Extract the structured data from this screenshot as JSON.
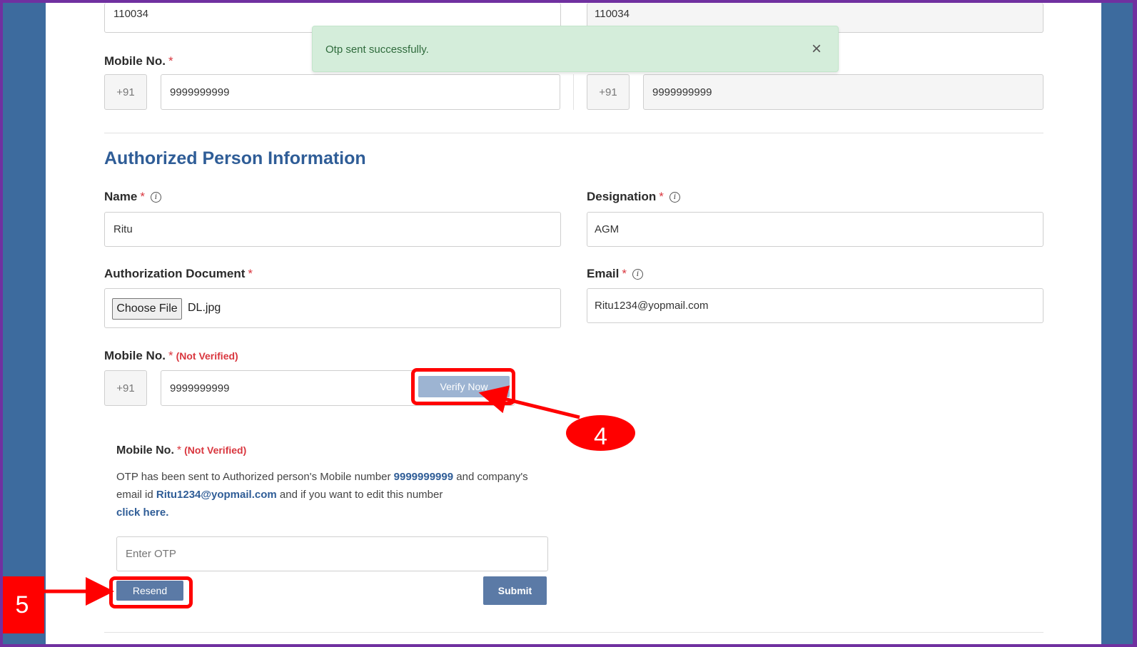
{
  "top": {
    "left_pincode": "110034",
    "right_pincode": "110034",
    "mobile_label": "Mobile No.",
    "required_mark": "*",
    "country_code": "+91",
    "left_mobile": "9999999999",
    "right_mobile": "9999999999"
  },
  "toast": {
    "message": "Otp sent successfully.",
    "close": "×"
  },
  "authorized": {
    "title": "Authorized Person Information",
    "name_label": "Name",
    "name_value": "Ritu",
    "designation_label": "Designation",
    "designation_value": "AGM",
    "doc_label": "Authorization Document",
    "choose_file": "Choose File",
    "file_name": "DL.jpg",
    "email_label": "Email",
    "email_value": "Ritu1234@yopmail.com",
    "mobile_label": "Mobile No.",
    "not_verified": "(Not Verified)",
    "country_code": "+91",
    "mobile_value": "9999999999",
    "verify_button": "Verify Now",
    "info_icon": "i"
  },
  "otp_panel": {
    "mobile_label": "Mobile No.",
    "not_verified": "(Not Verified)",
    "text_1": "OTP has been sent to Authorized person's Mobile number ",
    "mobile": "9999999999",
    "text_2": " and company's email id ",
    "email": "Ritu1234@yopmail.com",
    "text_3": " and if you want to edit this number ",
    "click_here": "click here.",
    "otp_placeholder": "Enter OTP",
    "resend_button": "Resend",
    "submit_button": "Submit"
  },
  "annotations": {
    "step_4": "4",
    "step_5": "5",
    "highlight_color": "#ff0000"
  },
  "colors": {
    "frame": "#7030a0",
    "side_panel": "#3d6b9e",
    "section_title": "#2f5d97",
    "button": "#5b7aa6",
    "toast_bg": "#d4edda"
  }
}
